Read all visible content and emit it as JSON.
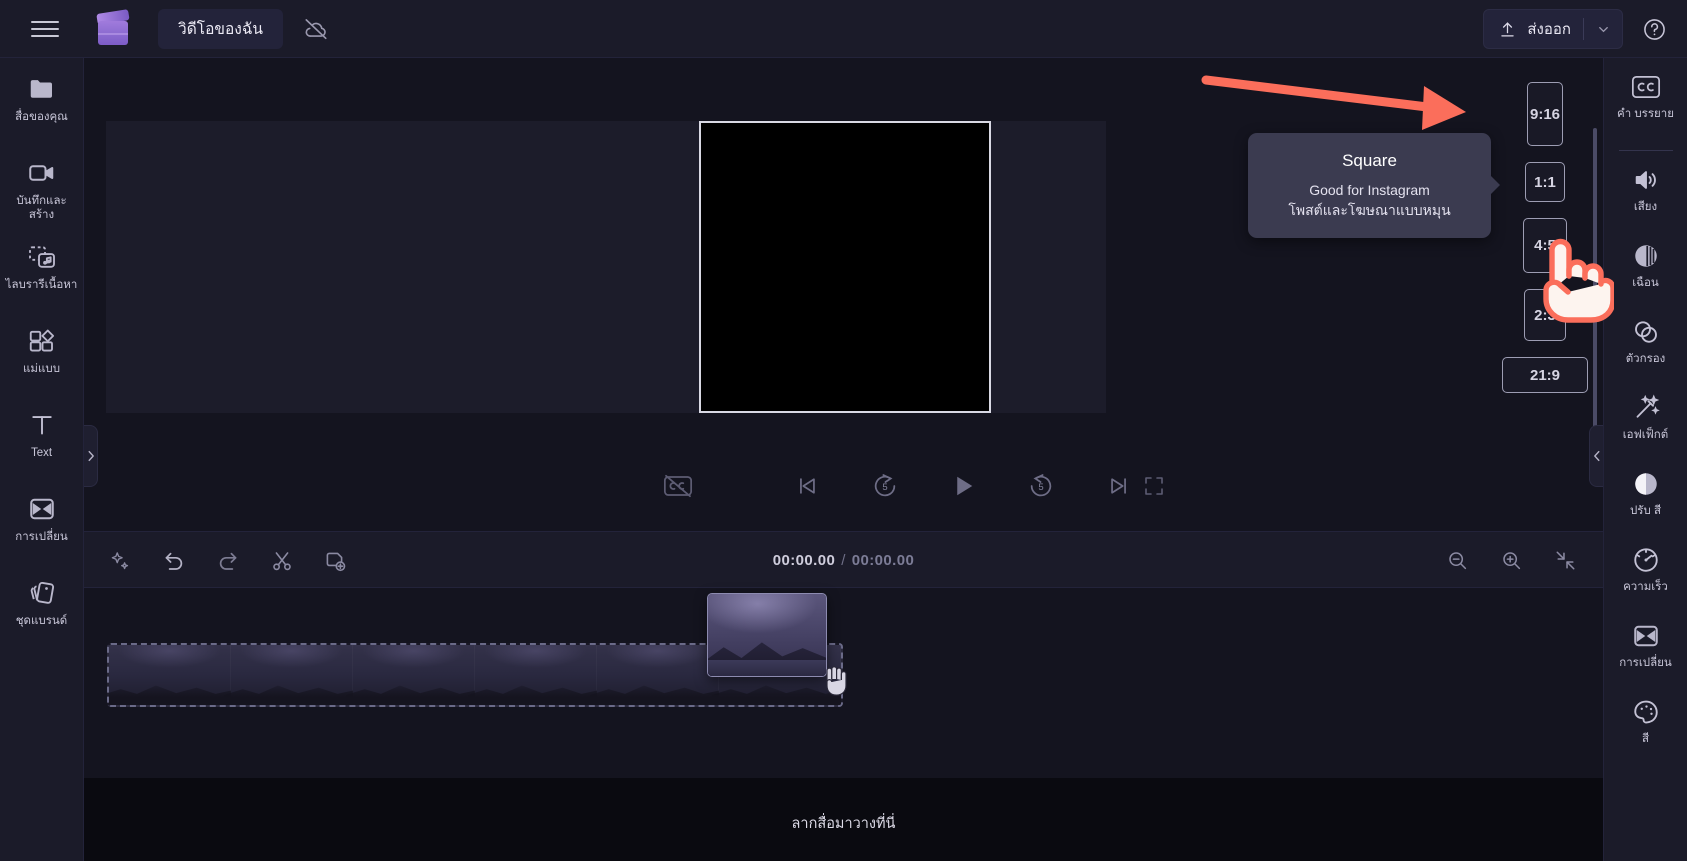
{
  "topbar": {
    "menu_icon": "hamburger-menu-icon",
    "logo_icon": "clipchamp-logo-icon",
    "project_title": "วิดีโอของฉัน",
    "cloud_status_icon": "cloud-off-icon",
    "export_label": "ส่งออก",
    "export_icon": "upload-arrow-icon",
    "export_chevron_icon": "chevron-down-icon",
    "help_icon": "question-circle-icon"
  },
  "left_rail": [
    {
      "label": "สื่อของคุณ",
      "icon": "folder-icon"
    },
    {
      "label": "บันทึกและสร้าง",
      "icon": "video-camera-icon"
    },
    {
      "label": "ไลบรารีเนื้อหา",
      "icon": "content-library-icon"
    },
    {
      "label": "แม่แบบ",
      "icon": "templates-icon"
    },
    {
      "label": "Text",
      "icon": "text-t-icon"
    },
    {
      "label": "การเปลี่ยน",
      "icon": "transitions-icon"
    },
    {
      "label": "ชุดแบรนด์",
      "icon": "brand-kit-icon"
    }
  ],
  "right_rail": [
    {
      "label": "คำ บรรยาย",
      "icon": "closed-caption-icon"
    },
    {
      "label": "เสียง",
      "icon": "speaker-volume-icon"
    },
    {
      "label": "เฉือน",
      "icon": "fade-icon"
    },
    {
      "label": "ตัวกรอง",
      "icon": "filters-icon"
    },
    {
      "label": "เอฟเฟ็กต์",
      "icon": "magic-wand-effects-icon"
    },
    {
      "label": "ปรับ สี",
      "icon": "adjust-color-icon"
    },
    {
      "label": "ความเร็ว",
      "icon": "speed-gauge-icon"
    },
    {
      "label": "การเปลี่ยน",
      "icon": "transitions-icon"
    },
    {
      "label": "สี",
      "icon": "color-palette-icon"
    }
  ],
  "aspect_panel": {
    "options": [
      {
        "label": "9:16",
        "name": "aspect-ratio-9-16"
      },
      {
        "label": "1:1",
        "name": "aspect-ratio-1-1"
      },
      {
        "label": "4:5",
        "name": "aspect-ratio-4-5"
      },
      {
        "label": "2:3",
        "name": "aspect-ratio-2-3"
      },
      {
        "label": "21:9",
        "name": "aspect-ratio-21-9"
      }
    ],
    "selected": "1:1"
  },
  "tooltip": {
    "title": "Square",
    "line1": "Good for Instagram",
    "line2": "โพสต์และโฆษณาแบบหมุน"
  },
  "player": {
    "cc_icon": "closed-caption-off-icon",
    "prev_icon": "skip-previous-icon",
    "back5_icon": "rewind-5-icon",
    "back5_label": "5",
    "play_icon": "play-icon",
    "fwd5_icon": "forward-5-icon",
    "fwd5_label": "5",
    "next_icon": "skip-next-icon",
    "fullscreen_icon": "fullscreen-icon"
  },
  "timeline_toolbar": {
    "tools": [
      {
        "name": "magic-sparkle-icon"
      },
      {
        "name": "undo-icon"
      },
      {
        "name": "redo-icon"
      },
      {
        "name": "split-scissors-icon"
      },
      {
        "name": "duplicate-icon"
      }
    ],
    "current_time": "00:00.00",
    "separator": "/",
    "total_time": "00:00.00",
    "right_tools": [
      {
        "name": "zoom-out-icon"
      },
      {
        "name": "zoom-in-icon"
      },
      {
        "name": "fit-to-screen-icon"
      }
    ]
  },
  "timeline": {
    "drop_hint": "ลากสื่อมาวางที่นี่",
    "drag_cursor_icon": "grab-hand-cursor-icon"
  },
  "annotation": {
    "arrow_icon": "red-arrow-annotation",
    "arrow_color": "#fb6e5b",
    "hand_cursor_icon": "pointing-hand-cursor"
  },
  "colors": {
    "app_bg": "#14141f",
    "panel_bg": "#1b1b29",
    "accent": "#8f6ed2",
    "annotation_red": "#fb6e5b",
    "tooltip_bg": "#3b3b50"
  }
}
